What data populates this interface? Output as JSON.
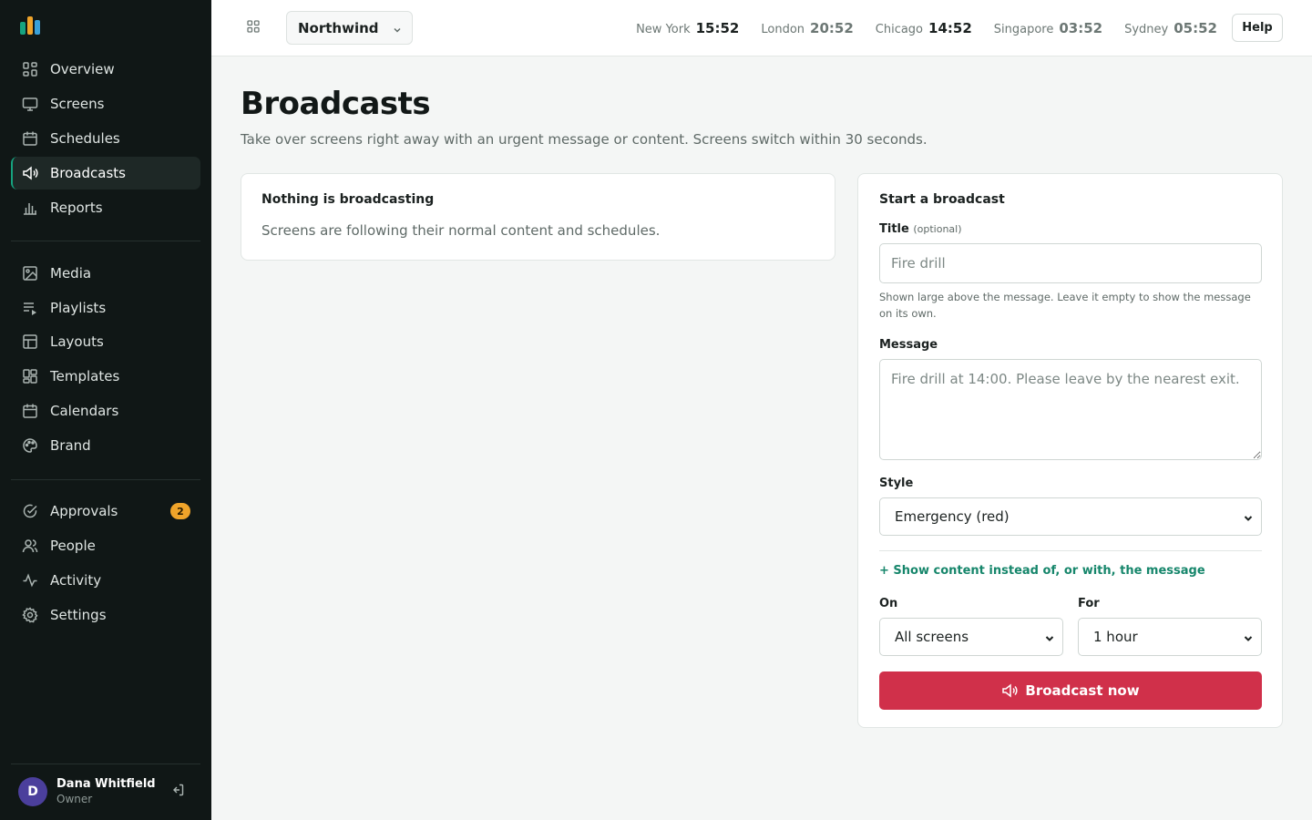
{
  "brand": {
    "logo_colors": [
      "#16a37f",
      "#f0a42a",
      "#3aa0d8"
    ]
  },
  "sidebar": {
    "items": [
      {
        "label": "Overview",
        "icon": "grid-icon"
      },
      {
        "label": "Screens",
        "icon": "monitor-icon"
      },
      {
        "label": "Schedules",
        "icon": "calendar-icon"
      },
      {
        "label": "Broadcasts",
        "icon": "megaphone-icon",
        "active": true
      },
      {
        "label": "Reports",
        "icon": "bar-chart-icon"
      },
      {
        "label": "Media",
        "icon": "image-icon"
      },
      {
        "label": "Playlists",
        "icon": "playlist-icon"
      },
      {
        "label": "Layouts",
        "icon": "layout-icon"
      },
      {
        "label": "Templates",
        "icon": "templates-icon"
      },
      {
        "label": "Calendars",
        "icon": "calendar-icon"
      },
      {
        "label": "Brand",
        "icon": "palette-icon"
      },
      {
        "label": "Approvals",
        "icon": "check-circle-icon",
        "badge": "2"
      },
      {
        "label": "People",
        "icon": "people-icon"
      },
      {
        "label": "Activity",
        "icon": "activity-icon"
      },
      {
        "label": "Settings",
        "icon": "gear-icon"
      }
    ],
    "user": {
      "initial": "D",
      "name": "Dana Whitfield",
      "role": "Owner"
    }
  },
  "topbar": {
    "workspace": "Northwind",
    "clocks": [
      {
        "city": "New York",
        "time": "15:52"
      },
      {
        "city": "London",
        "time": "20:52"
      },
      {
        "city": "Chicago",
        "time": "14:52"
      },
      {
        "city": "Singapore",
        "time": "03:52"
      },
      {
        "city": "Sydney",
        "time": "05:52"
      }
    ],
    "help_label": "Help"
  },
  "main": {
    "title": "Broadcasts",
    "subtitle": "Take over screens right away with an urgent message or content. Screens switch within 30 seconds.",
    "status": {
      "title": "Nothing is broadcasting",
      "text": "Screens are following their normal content and schedules."
    },
    "form": {
      "heading": "Start a broadcast",
      "title_label": "Title",
      "title_optional": "(optional)",
      "title_placeholder": "Fire drill",
      "title_hint": "Shown large above the message. Leave it empty to show the message on its own.",
      "message_label": "Message",
      "message_placeholder": "Fire drill at 14:00. Please leave by the nearest exit.",
      "style_label": "Style",
      "style_value": "Emergency (red)",
      "content_link": "+ Show content instead of, or with, the message",
      "on_label": "On",
      "on_value": "All screens",
      "for_label": "For",
      "for_value": "1 hour",
      "submit_label": "Broadcast now"
    }
  },
  "colors": {
    "accent": "#16a37f",
    "danger": "#d0304a",
    "sidebar_bg": "#101716",
    "badge": "#f0a42a"
  }
}
